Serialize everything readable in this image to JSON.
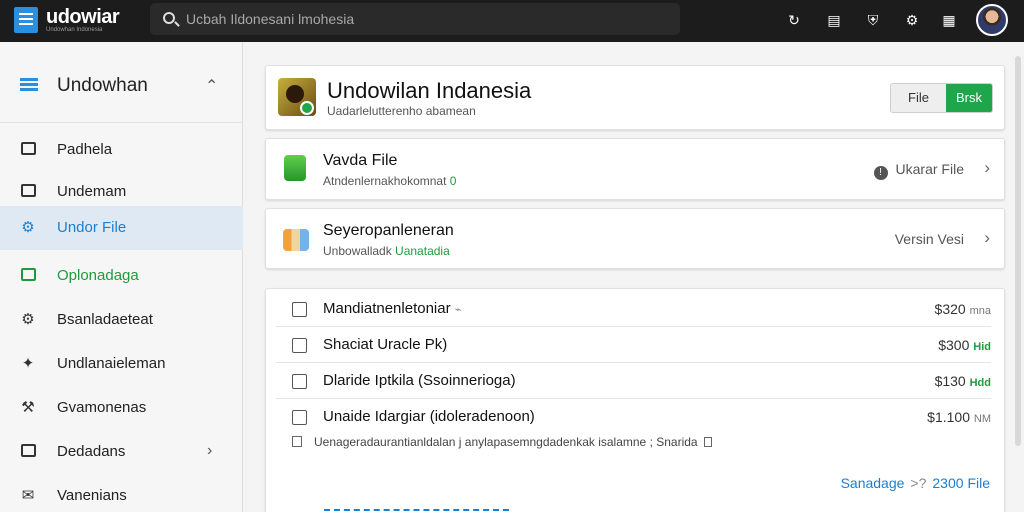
{
  "topbar": {
    "app_title": "udowiar",
    "app_subtitle": "Undowhan Indonesia",
    "search_placeholder": "Ucbah Ildonesani lmohesia",
    "icons": [
      "refresh-icon",
      "clipboard-icon",
      "shield-icon",
      "gear-icon",
      "grid-icon",
      "avatar"
    ]
  },
  "sidebar": {
    "header": "Undowhan",
    "items": [
      {
        "label": "Padhela",
        "icon": "check-box-icon"
      },
      {
        "label": "Undemam",
        "icon": "chart-box-icon"
      },
      {
        "label": "Undor File",
        "icon": "gear-icon",
        "active": true
      },
      {
        "label": "Oplonadaga",
        "icon": "check-box-icon"
      },
      {
        "label": "Bsanladaeteat",
        "icon": "settings-icon"
      },
      {
        "label": "Undlanaieleman",
        "icon": "puzzle-icon"
      },
      {
        "label": "Gvamonenas",
        "icon": "wrench-icon"
      },
      {
        "label": "Dedadans",
        "icon": "book-icon"
      },
      {
        "label": "Vanenians",
        "icon": "mail-icon"
      }
    ]
  },
  "main": {
    "header_card": {
      "title": "Undowilan Indanesia",
      "subtitle": "Uadarlelutterenho abamean",
      "file_button": "File",
      "go_button": "Brsk"
    },
    "rows": [
      {
        "title": "Vavda File",
        "subtitle_prefix": "Atndenlernakhokomnat ",
        "subtitle_highlight": "0",
        "right_text": "Ukarar File"
      },
      {
        "title": "Seyeropanleneran",
        "subtitle_prefix": "Unbowalladk ",
        "subtitle_highlight": "Uanatadia",
        "right_text": "Versin Vesi"
      }
    ],
    "list": [
      {
        "label": "Mandiatnenletoniar",
        "suffix": "⌁",
        "price": "$320",
        "unit": "mna",
        "green": false
      },
      {
        "label": "Shaciat Uracle Pk)",
        "suffix": "",
        "price": "$300",
        "unit": "Hid",
        "green": true
      },
      {
        "label": "Dlaride Iptkila (Ssoinnerioga)",
        "suffix": "",
        "price": "$130",
        "unit": "Hdd",
        "green": true
      },
      {
        "label": "Unaide Idargiar (idoleradenoon)",
        "suffix": "",
        "price": "$1.100",
        "unit": "NM",
        "green": false
      }
    ],
    "note": "Uenageradaurantianldalan j anylapasemngdadenkak isalamne ; Snarida",
    "footer": {
      "link_text": "Sanadage",
      "marker": ">?",
      "count": "2300",
      "count_label": "File"
    }
  }
}
